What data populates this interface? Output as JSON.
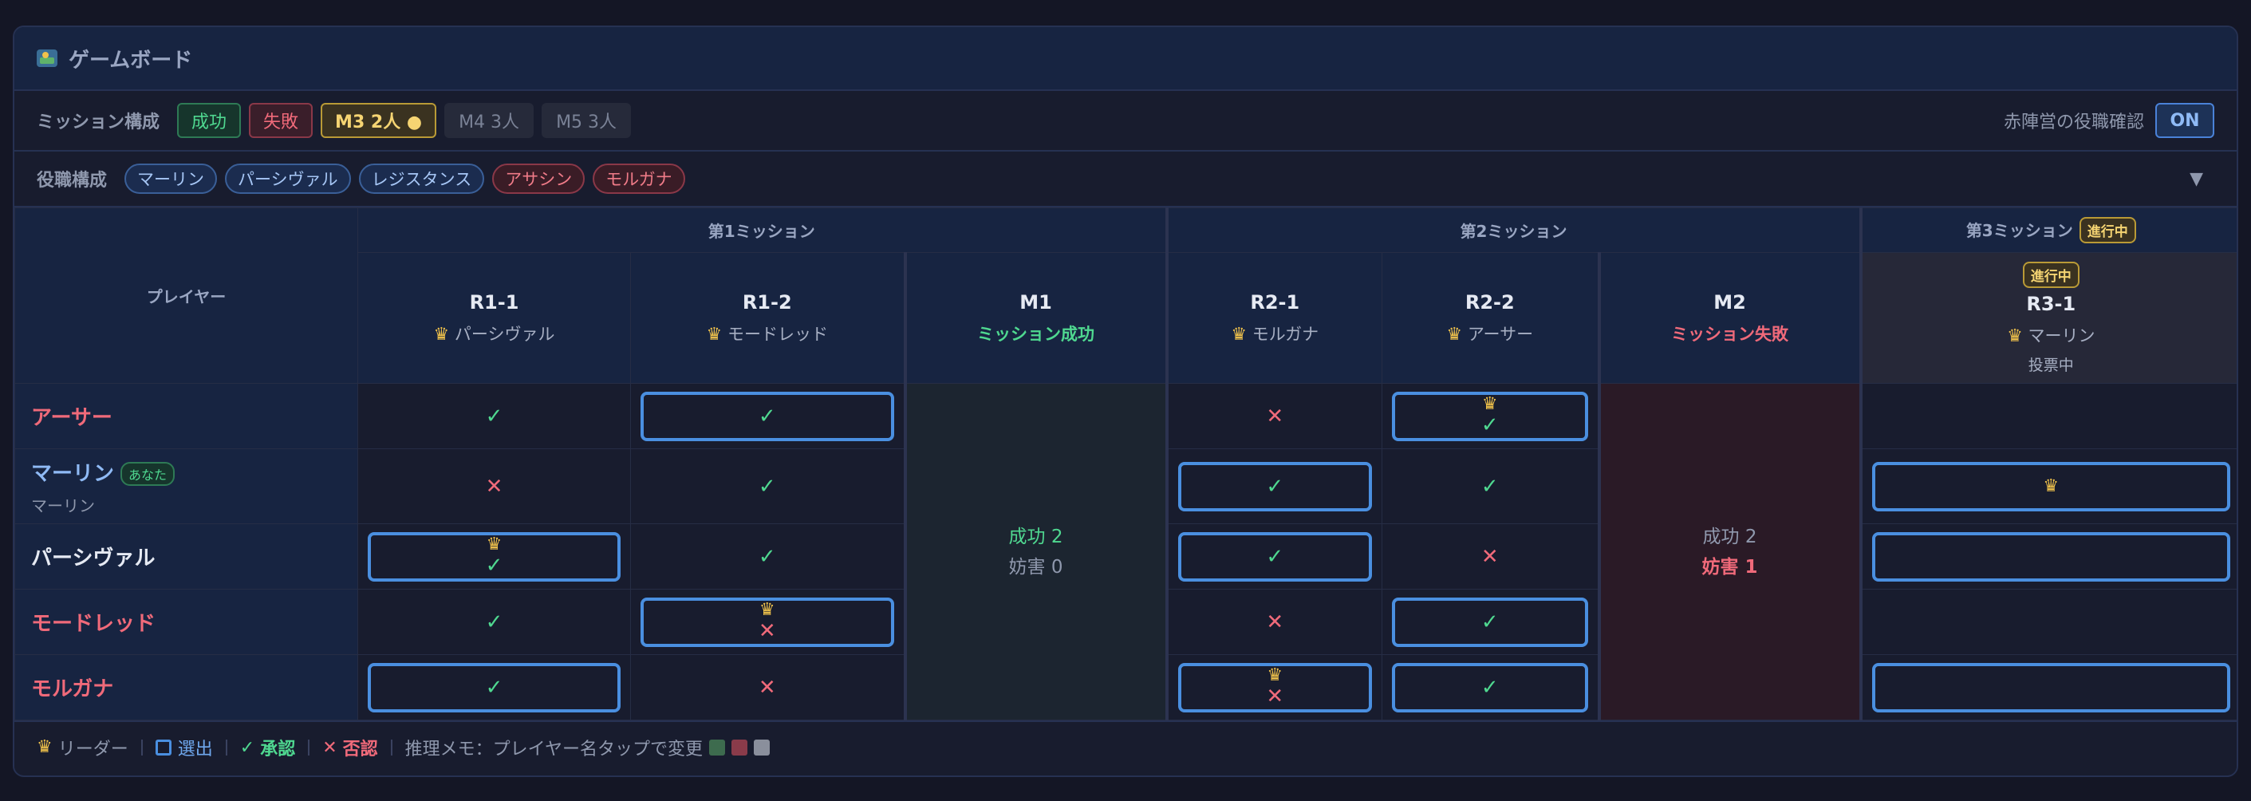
{
  "header": {
    "icon": "map-icon",
    "title": "ゲームボード"
  },
  "mission_bar": {
    "label": "ミッション構成",
    "chips": [
      {
        "label": "成功",
        "state": "success"
      },
      {
        "label": "失敗",
        "state": "fail"
      },
      {
        "label": "M3 2人 ●",
        "state": "current"
      },
      {
        "label": "M4 3人",
        "state": "future"
      },
      {
        "label": "M5 3人",
        "state": "future"
      }
    ],
    "red_check_label": "赤陣営の役職確認",
    "toggle_label": "ON"
  },
  "role_bar": {
    "label": "役職構成",
    "roles": [
      {
        "label": "マーリン",
        "side": "good"
      },
      {
        "label": "パーシヴァル",
        "side": "good"
      },
      {
        "label": "レジスタンス",
        "side": "good"
      },
      {
        "label": "アサシン",
        "side": "evil"
      },
      {
        "label": "モルガナ",
        "side": "evil"
      }
    ],
    "expand_icon": "chevron-down-icon",
    "expand_glyph": "▼"
  },
  "table": {
    "player_header": "プレイヤー",
    "groups": [
      {
        "label": "第1ミッション"
      },
      {
        "label": "第2ミッション"
      },
      {
        "label": "第3ミッション",
        "badge": "進行中"
      }
    ],
    "rounds": [
      {
        "code": "R1-1",
        "leader": "パーシヴァル"
      },
      {
        "code": "R1-2",
        "leader": "モードレッド"
      },
      {
        "code": "M1",
        "result": "ミッション成功"
      },
      {
        "code": "R2-1",
        "leader": "モルガナ"
      },
      {
        "code": "R2-2",
        "leader": "アーサー"
      },
      {
        "code": "M2",
        "result": "ミッション失敗"
      },
      {
        "code": "R3-1",
        "leader": "マーリン",
        "badge": "進行中",
        "status": "投票中"
      }
    ],
    "players": [
      {
        "name": "アーサー",
        "you": "",
        "role": ""
      },
      {
        "name": "マーリン",
        "you": "あなた",
        "role": "マーリン"
      },
      {
        "name": "パーシヴァル",
        "you": "",
        "role": ""
      },
      {
        "name": "モードレッド",
        "you": "",
        "role": ""
      },
      {
        "name": "モルガナ",
        "you": "",
        "role": ""
      }
    ],
    "m1_summary": {
      "success": "成功 2",
      "sabotage": "妨害 0"
    },
    "m2_summary": {
      "success": "成功 2",
      "sabotage": "妨害 1"
    }
  },
  "legend": {
    "leader": "リーダー",
    "selected": "選出",
    "approve": "承認",
    "reject": "否認",
    "memo": "推理メモ：プレイヤー名タップで変更",
    "colors": [
      "#3d6b4e",
      "#8a3b4a",
      "#8a8f9c"
    ]
  },
  "glyphs": {
    "approve": "✓",
    "reject": "✕",
    "crown": "♛"
  },
  "colors": {
    "accent": "#4a8fe0",
    "success": "#4fd890",
    "fail": "#f06a7a",
    "leader": "#f0c24b"
  }
}
